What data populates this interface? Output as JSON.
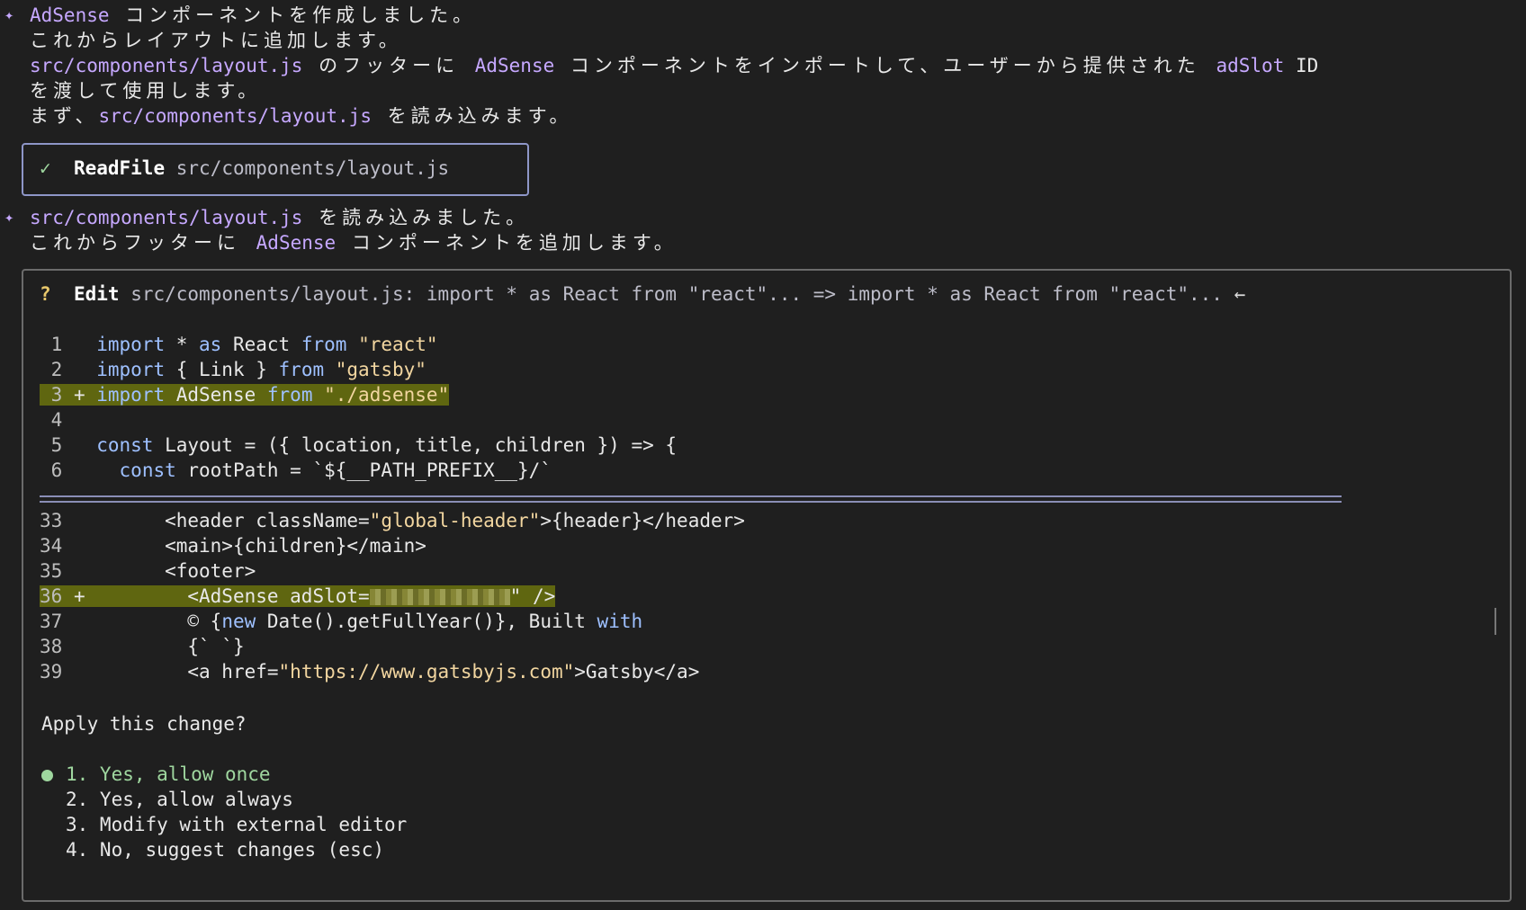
{
  "messages": {
    "m1_adsense": "AdSense",
    "m1_line1_rest": " コンポーネントを作成しました。",
    "m1_line2": "これからレイアウトに追加します。",
    "m1_line3_path": "src/components/layout.js",
    "m1_line3_a": " のフッターに ",
    "m1_line3_adsense": "AdSense",
    "m1_line3_b": " コンポーネントをインポートして、ユーザーから提供された ",
    "m1_line3_adslot": "adSlot",
    "m1_line3_id": " ID",
    "m1_line4": "を渡して使用します。",
    "m1_line5_a": "まず、",
    "m1_line5_path": "src/components/layout.js",
    "m1_line5_b": " を読み込みます。",
    "m2_line1_path": "src/components/layout.js",
    "m2_line1_rest": " を読み込みました。",
    "m2_line2_a": "これからフッターに ",
    "m2_line2_adsense": "AdSense",
    "m2_line2_b": " コンポーネントを追加します。"
  },
  "readfile": {
    "check": "✓",
    "tool": "ReadFile",
    "path": "src/components/layout.js"
  },
  "edit": {
    "q": "?",
    "tool": "Edit",
    "desc": "src/components/layout.js: import * as React from \"react\"... => import * as React from \"react\"...",
    "arrow": "←"
  },
  "code_top": [
    {
      "num": "1",
      "sign": " ",
      "tokens": [
        [
          "kw",
          "import"
        ],
        [
          "",
          " * "
        ],
        [
          "kw",
          "as"
        ],
        [
          "",
          " React "
        ],
        [
          "kw",
          "from"
        ],
        [
          "",
          " "
        ],
        [
          "str",
          "\"react\""
        ]
      ]
    },
    {
      "num": "2",
      "sign": " ",
      "tokens": [
        [
          "kw",
          "import"
        ],
        [
          "",
          " { Link } "
        ],
        [
          "kw",
          "from"
        ],
        [
          "",
          " "
        ],
        [
          "str",
          "\"gatsby\""
        ]
      ]
    },
    {
      "num": "3",
      "sign": "+",
      "tokens": [
        [
          "kw",
          "import"
        ],
        [
          "",
          " AdSense "
        ],
        [
          "kw",
          "from"
        ],
        [
          "",
          " "
        ],
        [
          "str",
          "\"./adsense\""
        ]
      ]
    },
    {
      "num": "4",
      "sign": " ",
      "tokens": []
    },
    {
      "num": "5",
      "sign": " ",
      "tokens": [
        [
          "kw",
          "const"
        ],
        [
          "",
          " Layout = ({ location, title, children }) => {"
        ]
      ]
    },
    {
      "num": "6",
      "sign": " ",
      "tokens": [
        [
          "",
          "  "
        ],
        [
          "kw",
          "const"
        ],
        [
          "",
          " rootPath = `${__PATH_PREFIX__}/`"
        ]
      ]
    }
  ],
  "code_bottom": [
    {
      "num": "33",
      "sign": " ",
      "tokens": [
        [
          "",
          "      <header className="
        ],
        [
          "str",
          "\"global-header\""
        ],
        [
          "",
          ">{header}</header>"
        ]
      ]
    },
    {
      "num": "34",
      "sign": " ",
      "tokens": [
        [
          "",
          "      <main>{children}</main>"
        ]
      ]
    },
    {
      "num": "35",
      "sign": " ",
      "tokens": [
        [
          "",
          "      <footer>"
        ]
      ]
    },
    {
      "num": "36",
      "sign": "+",
      "tokens": [
        [
          "",
          "        <AdSense adSlot="
        ],
        [
          "blur",
          ""
        ],
        [
          "",
          "\" />"
        ]
      ]
    },
    {
      "num": "37",
      "sign": " ",
      "tokens": [
        [
          "",
          "        © {"
        ],
        [
          "kw",
          "new"
        ],
        [
          "",
          " Date().getFullYear()}, Built "
        ],
        [
          "kw",
          "with"
        ]
      ]
    },
    {
      "num": "38",
      "sign": " ",
      "tokens": [
        [
          "",
          "        {` `}"
        ]
      ]
    },
    {
      "num": "39",
      "sign": " ",
      "tokens": [
        [
          "",
          "        <a href="
        ],
        [
          "str",
          "\"https://www.gatsbyjs.com\""
        ],
        [
          "",
          ">Gatsby</a>"
        ]
      ]
    }
  ],
  "prompt": {
    "question": "Apply this change?",
    "options": [
      "1. Yes, allow once",
      "2. Yes, allow always",
      "3. Modify with external editor",
      "4. No, suggest changes (esc)"
    ]
  }
}
